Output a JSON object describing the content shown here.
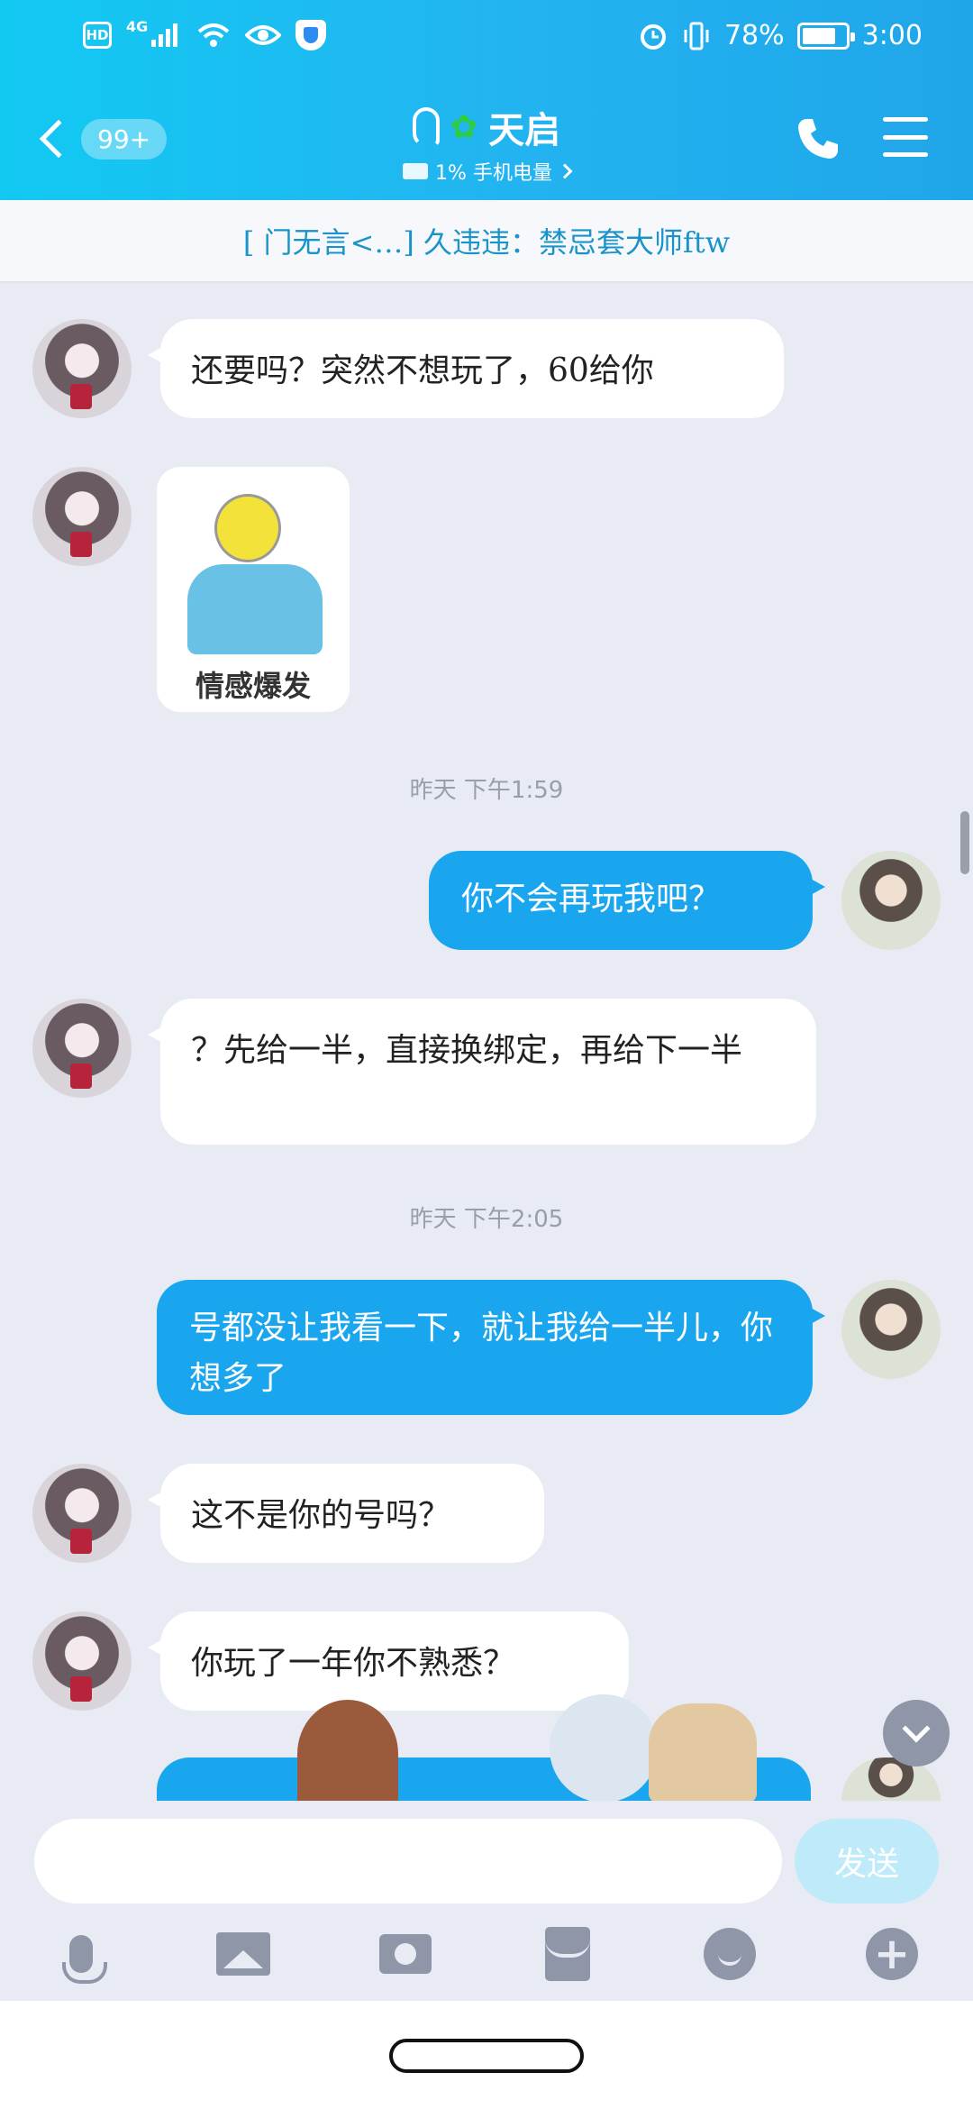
{
  "status_bar": {
    "battery": "78%",
    "time": "3:00",
    "network": "4G",
    "hd": "HD"
  },
  "header": {
    "unread_count": "99+",
    "title": "天启",
    "subtitle": "1% 手机电量",
    "phone_icon": "phone-icon",
    "menu_icon": "menu-icon"
  },
  "announcement": "[ 门无言<…] 久违违：禁忌套大师ftw",
  "messages": [
    {
      "side": "left",
      "text": "还要吗？突然不想玩了，60给你"
    },
    {
      "side": "left",
      "type": "sticker",
      "text": "情感爆发"
    },
    {
      "type": "time",
      "text": "昨天 下午1:59"
    },
    {
      "side": "right",
      "text": "你不会再玩我吧？"
    },
    {
      "side": "left",
      "text": "？先给一半，直接换绑定，再给下一半"
    },
    {
      "type": "time",
      "text": "昨天 下午2:05"
    },
    {
      "side": "right",
      "text": "号都没让我看一下，就让我给一半儿，你想多了"
    },
    {
      "side": "left",
      "text": "这不是你的号吗？"
    },
    {
      "side": "left",
      "text": "你玩了一年你不熟悉？"
    }
  ],
  "input": {
    "placeholder": "",
    "send_label": "发送"
  },
  "toolbar": [
    "mic-icon",
    "image-icon",
    "camera-icon",
    "red-packet-icon",
    "emoji-icon",
    "plus-icon"
  ],
  "colors": {
    "header": "#1fb4f0",
    "bubble_right": "#1aa6ee",
    "background": "#e8ebf3"
  }
}
